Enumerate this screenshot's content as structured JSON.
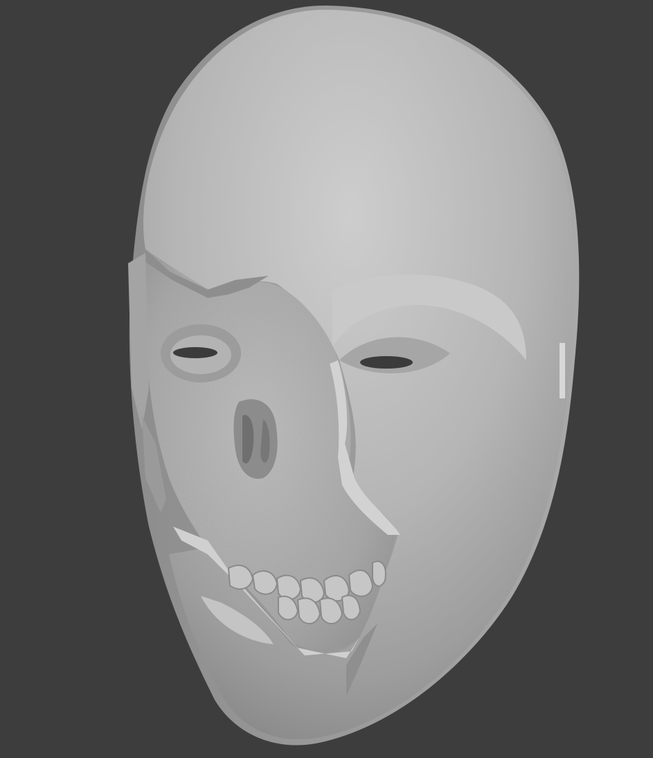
{
  "viewport": {
    "background_color": "#3d3d3d",
    "mesh_base_color": "#b4b4b4",
    "mesh_shadow_color": "#8a8a8a",
    "mesh_highlight_color": "#cfcfcf"
  },
  "scene": {
    "object_name": "sculpted-face-mask",
    "features": [
      "cracked-shell",
      "exposed-skull",
      "eye-slits",
      "teeth"
    ]
  }
}
